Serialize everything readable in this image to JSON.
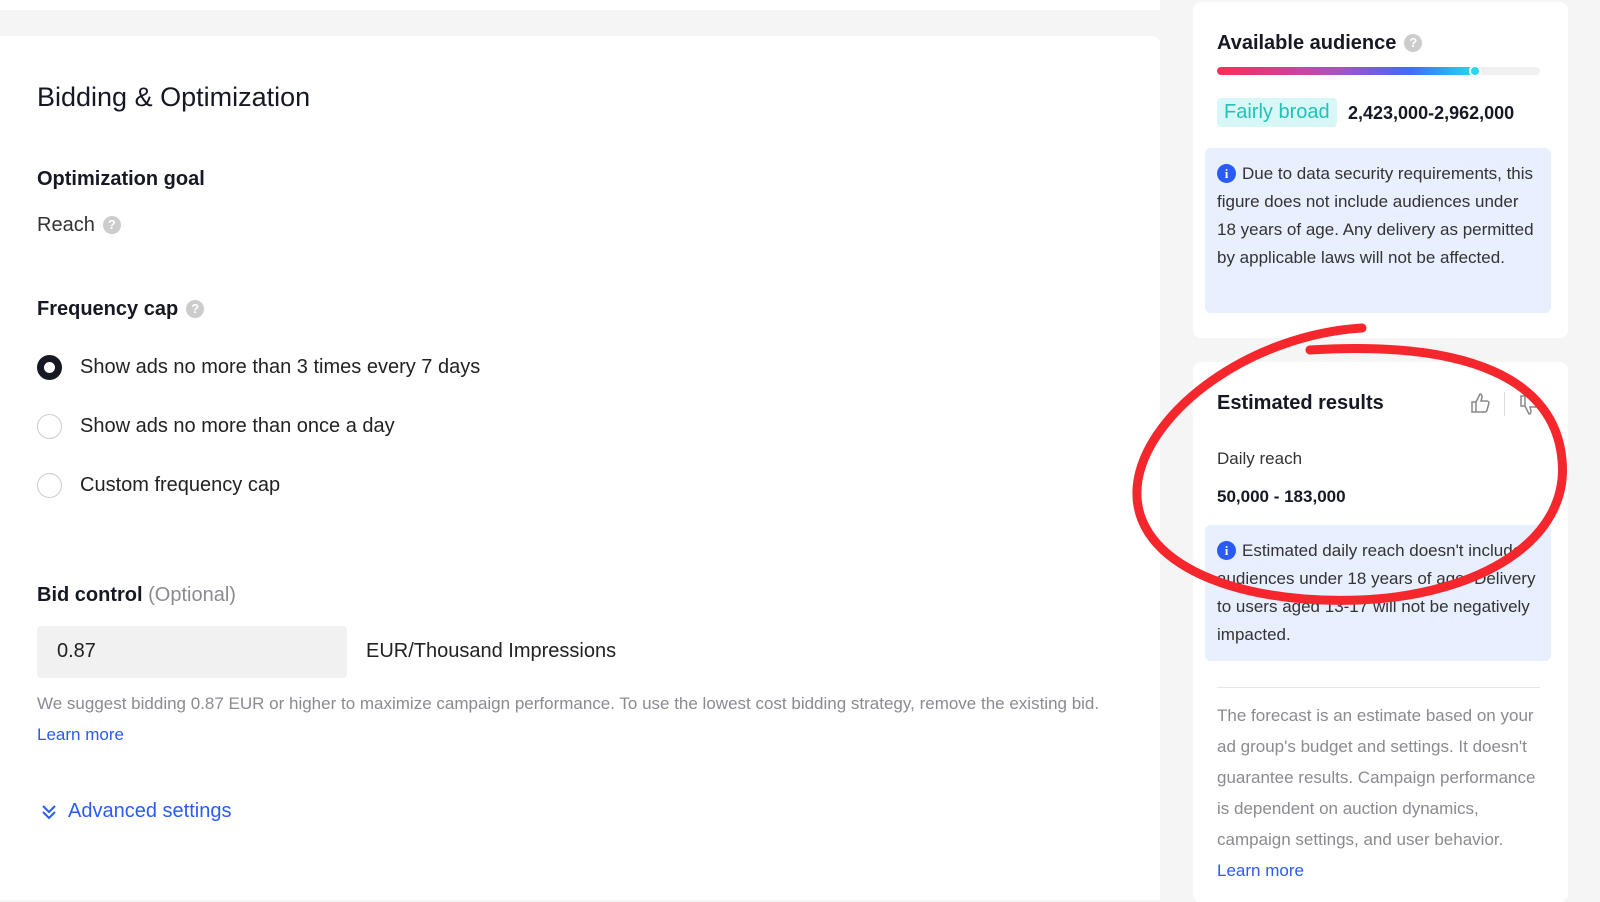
{
  "bidding": {
    "title": "Bidding & Optimization",
    "optimization_goal_label": "Optimization goal",
    "optimization_goal_value": "Reach",
    "frequency_cap_label": "Frequency cap",
    "frequency_options": [
      {
        "label": "Show ads no more than 3 times every 7 days",
        "selected": true
      },
      {
        "label": "Show ads no more than once a day",
        "selected": false
      },
      {
        "label": "Custom frequency cap",
        "selected": false
      }
    ],
    "bid_control_label": "Bid control",
    "bid_control_optional": "(Optional)",
    "bid_value": "0.87",
    "bid_unit": "EUR/Thousand Impressions",
    "hint": "We suggest bidding 0.87 EUR or higher to maximize campaign performance. To use the lowest cost bidding strategy, remove the existing bid.",
    "learn_more": "Learn more",
    "advanced_settings": "Advanced settings"
  },
  "audience": {
    "title": "Available audience",
    "level_fraction": 0.8,
    "badge": "Fairly broad",
    "range": "2,423,000-2,962,000",
    "info": "Due to data security requirements, this figure does not include audiences under 18 years of age. Any delivery as permitted by applicable laws will not be affected."
  },
  "estimated": {
    "title": "Estimated results",
    "daily_reach_label": "Daily reach",
    "daily_reach_value": "50,000 - 183,000",
    "info": "Estimated daily reach doesn't include audiences under 18 years of age. Delivery to users aged 13-17 will not be negatively impacted.",
    "forecast": "The forecast is an estimate based on your ad group's budget and settings. It doesn't guarantee results. Campaign performance is dependent on auction dynamics, campaign settings, and user behavior.",
    "learn_more": "Learn more"
  },
  "colors": {
    "accent": "#2a5bf6",
    "annotation": "#f5262c",
    "badge": "#1fc3b8"
  }
}
